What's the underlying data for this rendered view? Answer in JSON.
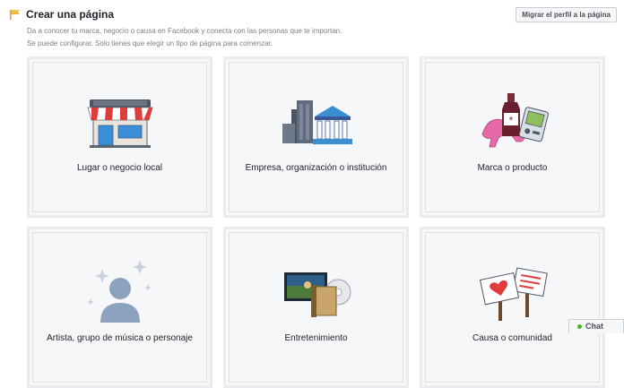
{
  "header": {
    "title": "Crear una página",
    "line1": "Da a conocer tu marca, negocio o causa en Facebook y conecta con las personas que te importan.",
    "line2": "Se puede configurar. Solo tienes que elegir un tipo de página para comenzar.",
    "migrate_button": "Migrar el perfil a la página"
  },
  "cards": [
    {
      "label": "Lugar o negocio local",
      "icon": "storefront-icon"
    },
    {
      "label": "Empresa, organización o institución",
      "icon": "company-building-icon"
    },
    {
      "label": "Marca o producto",
      "icon": "brand-product-icon"
    },
    {
      "label": "Artista, grupo de música o personaje",
      "icon": "artist-icon"
    },
    {
      "label": "Entretenimiento",
      "icon": "entertainment-icon"
    },
    {
      "label": "Causa o comunidad",
      "icon": "cause-community-icon"
    }
  ],
  "chat": {
    "label": "Chat",
    "status_color": "#42b72a"
  }
}
